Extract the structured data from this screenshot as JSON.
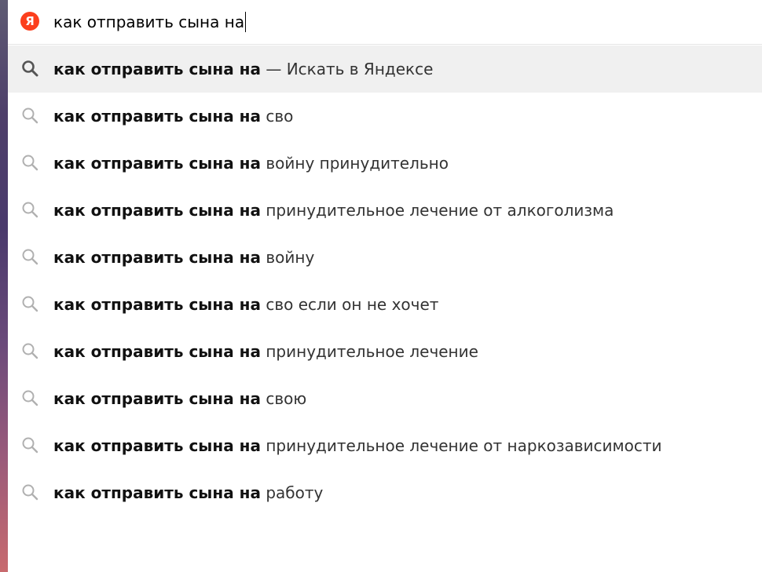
{
  "search": {
    "logo_letter": "Я",
    "query": "как отправить сына на"
  },
  "suggestions": [
    {
      "bold": "как отправить сына на",
      "rest": " — Искать в Яндексе"
    },
    {
      "bold": "как отправить сына на",
      "rest": " сво"
    },
    {
      "bold": "как отправить сына на",
      "rest": " войну принудительно"
    },
    {
      "bold": "как отправить сына на",
      "rest": " принудительное лечение от алкоголизма"
    },
    {
      "bold": "как отправить сына на",
      "rest": " войну"
    },
    {
      "bold": "как отправить сына на",
      "rest": " сво если он не хочет"
    },
    {
      "bold": "как отправить сына на",
      "rest": " принудительное лечение"
    },
    {
      "bold": "как отправить сына на",
      "rest": " свою"
    },
    {
      "bold": "как отправить сына на",
      "rest": " принудительное лечение от наркозависимости"
    },
    {
      "bold": "как отправить сына на",
      "rest": " работу"
    }
  ],
  "colors": {
    "logo": "#fc3f1d",
    "active_row": "#f0f0f0",
    "active_icon": "#555555",
    "icon": "#b0b0b0"
  }
}
